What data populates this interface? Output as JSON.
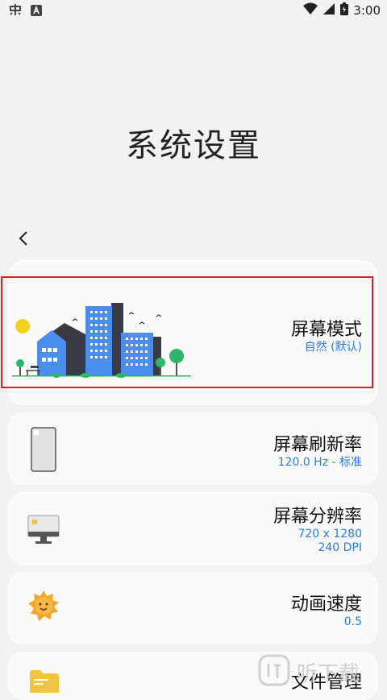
{
  "status_bar": {
    "time": "3:00"
  },
  "page": {
    "title": "系统设置"
  },
  "cards": [
    {
      "title": "屏幕模式",
      "value": "自然 (默认)"
    },
    {
      "title": "屏幕刷新率",
      "value": "120.0 Hz - 标准"
    },
    {
      "title": "屏幕分辨率",
      "value_line1": "720 x 1280",
      "value_line2": "240 DPI"
    },
    {
      "title": "动画速度",
      "value": "0.5"
    },
    {
      "title": "文件管理"
    }
  ],
  "watermark": {
    "text": "听下载"
  },
  "colors": {
    "accent": "#2a7be0",
    "highlight": "#e02020",
    "background": "#f2f2f2",
    "card": "#fafafa"
  }
}
